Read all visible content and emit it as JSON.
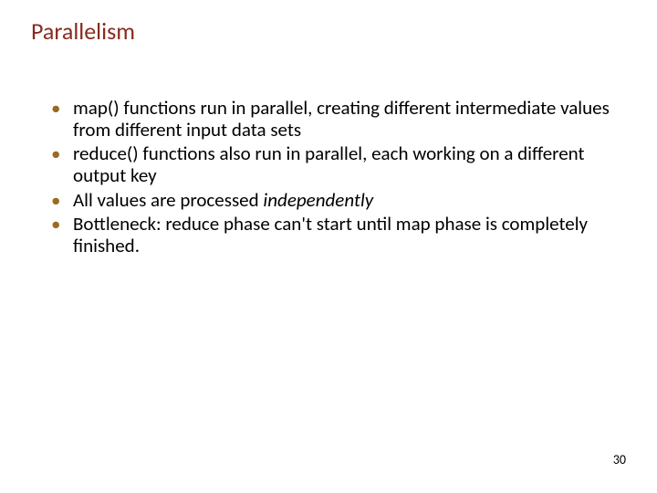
{
  "title": "Parallelism",
  "bullets": [
    {
      "pre": "map() functions run in parallel, creating different intermediate values from different input data sets",
      "ital": "",
      "post": ""
    },
    {
      "pre": "reduce() functions also run in parallel, each working on a different output key",
      "ital": "",
      "post": ""
    },
    {
      "pre": "All values are processed ",
      "ital": "independently",
      "post": ""
    },
    {
      "pre": "Bottleneck: reduce phase can't start until map phase is completely finished.",
      "ital": "",
      "post": ""
    }
  ],
  "page_number": "30"
}
